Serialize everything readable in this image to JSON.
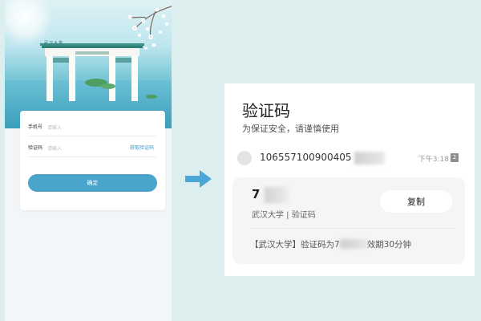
{
  "login": {
    "gate_plaque": "武汉大学",
    "phone_label": "手机号",
    "phone_placeholder": "请输入",
    "code_label": "验证码",
    "code_placeholder": "请输入",
    "get_code": "获取验证码",
    "confirm": "确定"
  },
  "arrow": {
    "icon": "right-arrow-icon",
    "color": "#4aa6d6"
  },
  "sms": {
    "title": "验证码",
    "subtitle": "为保证安全，请谨慎使用",
    "sender_number": "106557100900405",
    "time": "下午3:18",
    "sim_badge": "2",
    "code_prefix": "7",
    "code_meta": "武汉大学 | 验证码",
    "copy_label": "复制",
    "message_prefix": "【武汉大学】验证码为7",
    "message_suffix": "效期30分钟"
  },
  "colors": {
    "accent": "#49a5cc",
    "link": "#3e95c4",
    "page_background": "#dcefee"
  }
}
